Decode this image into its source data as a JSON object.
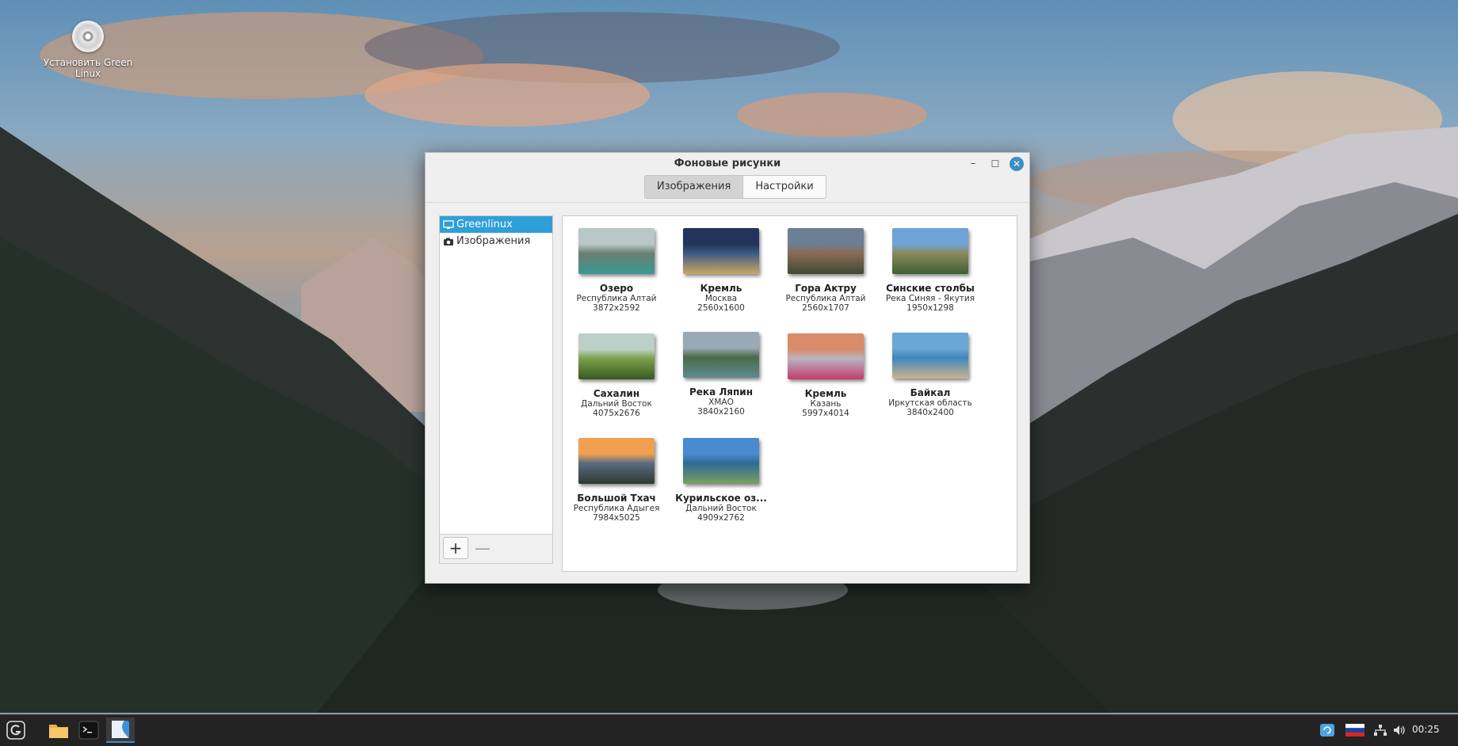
{
  "desktop": {
    "icon_label": "Установить Green Linux"
  },
  "window": {
    "title": "Фоновые рисунки",
    "minimize_glyph": "–",
    "maximize_glyph": "☐",
    "close_glyph": "✕",
    "tabs": [
      {
        "label": "Изображения",
        "active": true
      },
      {
        "label": "Настройки",
        "active": false
      }
    ],
    "sidebar": {
      "items": [
        {
          "label": "Greenlinux",
          "icon": "monitor-icon",
          "selected": true
        },
        {
          "label": "Изображения",
          "icon": "camera-icon",
          "selected": false
        }
      ],
      "add_label": "+",
      "remove_label": "—"
    },
    "wallpapers": [
      {
        "name": "Озеро",
        "location": "Республика Алтай",
        "size": "3872x2592",
        "colors": [
          "#b9c7c8",
          "#6b7d6e",
          "#3a9a96"
        ]
      },
      {
        "name": "Кремль",
        "location": "Москва",
        "size": "2560x1600",
        "colors": [
          "#22345a",
          "#3c5a88",
          "#c9a860"
        ]
      },
      {
        "name": "Гора Актру",
        "location": "Республика Алтай",
        "size": "2560x1707",
        "colors": [
          "#6d7f94",
          "#8a6a55",
          "#3d4a33"
        ]
      },
      {
        "name": "Синские столбы",
        "location": "Река Синяя - Якутия",
        "size": "1950x1298",
        "colors": [
          "#6fa3d8",
          "#8c8a5c",
          "#3d5f34"
        ]
      },
      {
        "name": "Сахалин",
        "location": "Дальний Восток",
        "size": "4075x2676",
        "colors": [
          "#bcd0c8",
          "#7aa04a",
          "#365a22"
        ]
      },
      {
        "name": "Река Ляпин",
        "location": "ХМАО",
        "size": "3840x2160",
        "colors": [
          "#9aaab5",
          "#4a6a48",
          "#5f8a90"
        ]
      },
      {
        "name": "Кремль",
        "location": "Казань",
        "size": "5997x4014",
        "colors": [
          "#d98b6a",
          "#b8b4c2",
          "#c43a6a"
        ]
      },
      {
        "name": "Байкал",
        "location": "Иркутская область",
        "size": "3840x2400",
        "colors": [
          "#6aa6d6",
          "#3f86c0",
          "#cdb38a"
        ]
      },
      {
        "name": "Большой Тхач",
        "location": "Республика Адыгея",
        "size": "7984x5025",
        "colors": [
          "#f0a050",
          "#5b6a82",
          "#2f3a2e"
        ]
      },
      {
        "name": "Курильское оз...",
        "location": "Дальний Восток",
        "size": "4909x2762",
        "colors": [
          "#4a8ad0",
          "#2e6a96",
          "#7aa060"
        ]
      }
    ]
  },
  "taskbar": {
    "clock": "00:25",
    "items": [
      "greenlinux-menu-icon",
      "folder-icon",
      "terminal-icon",
      "wallpaper-app-icon"
    ],
    "tray": [
      "update-icon",
      "russian-flag-icon",
      "network-icon",
      "volume-icon"
    ]
  }
}
